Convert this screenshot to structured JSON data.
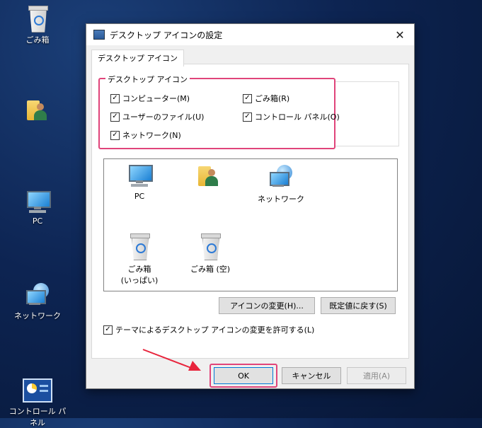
{
  "desktop": {
    "icons": [
      {
        "label": "ごみ箱"
      },
      {
        "label": "PC"
      },
      {
        "label": "ネットワーク"
      },
      {
        "label": "コントロール パネル"
      }
    ]
  },
  "dialog": {
    "title": "デスクトップ アイコンの設定",
    "close_glyph": "✕",
    "tab_label": "デスクトップ アイコン",
    "group_label": "デスクトップ アイコン",
    "checkboxes": [
      {
        "label": "コンピューター(M)",
        "checked": true
      },
      {
        "label": "ごみ箱(R)",
        "checked": true
      },
      {
        "label": "ユーザーのファイル(U)",
        "checked": true
      },
      {
        "label": "コントロール パネル(O)",
        "checked": true
      },
      {
        "label": "ネットワーク(N)",
        "checked": true
      }
    ],
    "icon_list": [
      {
        "label": "PC"
      },
      {
        "label": "ネットワーク"
      },
      {
        "label": "ごみ箱\n(いっぱい)"
      },
      {
        "label": "ごみ箱 (空)"
      }
    ],
    "change_icon_button": "アイコンの変更(H)...",
    "restore_default_button": "既定値に戻す(S)",
    "theme_checkbox": {
      "label": "テーマによるデスクトップ アイコンの変更を許可する(L)",
      "checked": true
    },
    "ok_button": "OK",
    "cancel_button": "キャンセル",
    "apply_button": "適用(A)",
    "check_glyph": "✓"
  },
  "colors": {
    "highlight": "#e0447a",
    "arrow": "#e8243c"
  }
}
